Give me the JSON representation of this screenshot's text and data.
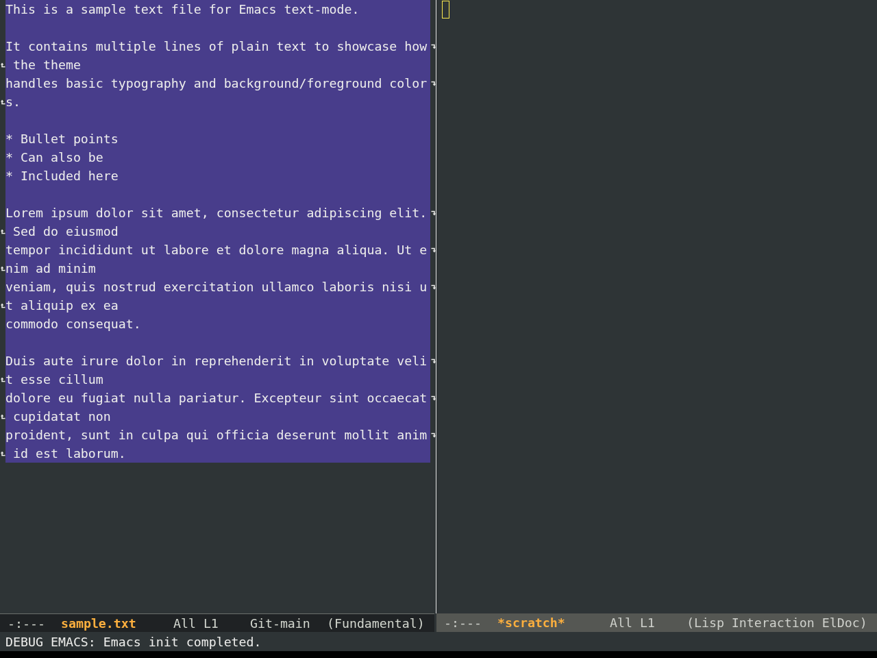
{
  "windows": [
    {
      "selected": true,
      "region_active": true,
      "lines": [
        {
          "kind": "text",
          "text": "This is a sample text file for Emacs text-mode.",
          "continues": false,
          "continuation": false
        },
        {
          "kind": "blank"
        },
        {
          "kind": "text",
          "text": "It contains multiple lines of plain text to showcase how",
          "continues": true,
          "continuation": false
        },
        {
          "kind": "text",
          "text": " the theme",
          "continues": false,
          "continuation": true
        },
        {
          "kind": "text",
          "text": "handles basic typography and background/foreground color",
          "continues": true,
          "continuation": false
        },
        {
          "kind": "text",
          "text": "s.",
          "continues": false,
          "continuation": true
        },
        {
          "kind": "blank"
        },
        {
          "kind": "text",
          "text": "* Bullet points",
          "continues": false,
          "continuation": false
        },
        {
          "kind": "text",
          "text": "* Can also be",
          "continues": false,
          "continuation": false
        },
        {
          "kind": "text",
          "text": "* Included here",
          "continues": false,
          "continuation": false
        },
        {
          "kind": "blank"
        },
        {
          "kind": "text",
          "text": "Lorem ipsum dolor sit amet, consectetur adipiscing elit.",
          "continues": true,
          "continuation": false
        },
        {
          "kind": "text",
          "text": " Sed do eiusmod",
          "continues": false,
          "continuation": true
        },
        {
          "kind": "text",
          "text": "tempor incididunt ut labore et dolore magna aliqua. Ut e",
          "continues": true,
          "continuation": false
        },
        {
          "kind": "text",
          "text": "nim ad minim",
          "continues": false,
          "continuation": true
        },
        {
          "kind": "text",
          "text": "veniam, quis nostrud exercitation ullamco laboris nisi u",
          "continues": true,
          "continuation": false
        },
        {
          "kind": "text",
          "text": "t aliquip ex ea",
          "continues": false,
          "continuation": true
        },
        {
          "kind": "text",
          "text": "commodo consequat.",
          "continues": false,
          "continuation": false
        },
        {
          "kind": "blank"
        },
        {
          "kind": "text",
          "text": "Duis aute irure dolor in reprehenderit in voluptate veli",
          "continues": true,
          "continuation": false
        },
        {
          "kind": "text",
          "text": "t esse cillum",
          "continues": false,
          "continuation": true
        },
        {
          "kind": "text",
          "text": "dolore eu fugiat nulla pariatur. Excepteur sint occaecat",
          "continues": true,
          "continuation": false
        },
        {
          "kind": "text",
          "text": " cupidatat non",
          "continues": false,
          "continuation": true
        },
        {
          "kind": "text",
          "text": "proident, sunt in culpa qui officia deserunt mollit anim",
          "continues": true,
          "continuation": false
        },
        {
          "kind": "text",
          "text": " id est laborum.",
          "continues": false,
          "continuation": true
        }
      ],
      "mode_line": [
        {
          "kind": "status",
          "text": "-:---"
        },
        {
          "kind": "buffer",
          "text": "sample.txt"
        },
        {
          "kind": "position",
          "text": "All L1"
        },
        {
          "kind": "vc",
          "text": "Git-main"
        },
        {
          "kind": "mode",
          "text": "(Fundamental)"
        }
      ]
    },
    {
      "selected": false,
      "cursor": true,
      "mode_line": [
        {
          "kind": "status",
          "text": "-:---"
        },
        {
          "kind": "buffer",
          "text": "*scratch*"
        },
        {
          "kind": "position",
          "text": "All L1"
        },
        {
          "kind": "mode",
          "text": "(Lisp Interaction ElDoc)"
        }
      ]
    }
  ],
  "echo_area": "DEBUG EMACS: Emacs init completed."
}
